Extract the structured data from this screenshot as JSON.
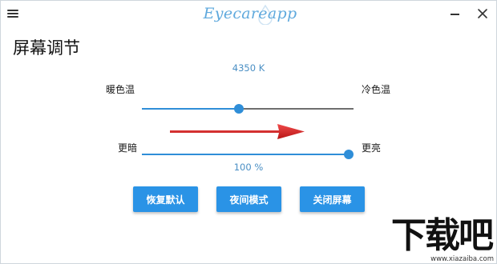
{
  "window": {
    "app_logo_text": "Eyecareapp"
  },
  "page": {
    "title": "屏幕调节"
  },
  "color_temperature": {
    "value_label": "4350 K",
    "warm_label": "暖色温",
    "cool_label": "冷色温",
    "level_fraction": 0.46
  },
  "brightness": {
    "value_label": "100 %",
    "dark_label": "更暗",
    "bright_label": "更亮",
    "level_fraction": 1.0
  },
  "buttons": {
    "restore_default": "恢复默认",
    "night_mode": "夜间模式",
    "turn_off_screen": "关闭屏幕"
  },
  "watermark": {
    "main": "下载吧",
    "url": "www.xiazaiba.com"
  },
  "colors": {
    "accent": "#2a93e6",
    "track": "#6e6e6e",
    "arrow": "#d42020",
    "logo": "#5fa9dd"
  }
}
